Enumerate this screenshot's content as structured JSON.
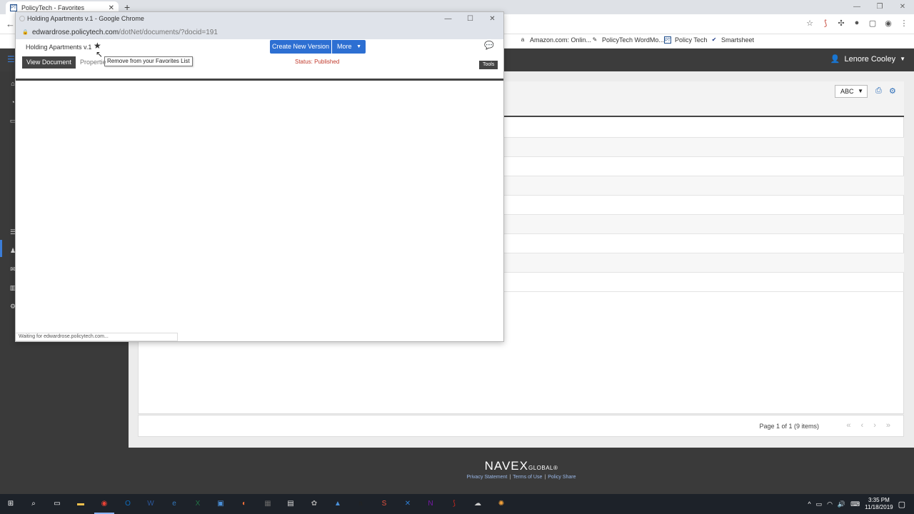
{
  "browser": {
    "tab_title": "PolicyTech - Favorites",
    "tab_favicon": "PT",
    "tab_close": "✕",
    "new_tab": "+",
    "back": "←",
    "window_controls": [
      "—",
      "❐",
      "✕"
    ]
  },
  "bookmarks": [
    {
      "label": "Amazon.com: Onlin...",
      "icon": "a"
    },
    {
      "label": "PolicyTech WordMo...",
      "icon": "✎"
    },
    {
      "label": "Policy Tech",
      "icon": "PT"
    },
    {
      "label": "Smartsheet",
      "icon": "✔"
    }
  ],
  "app": {
    "user_name": "Lenore Cooley",
    "menu_icon": "☰",
    "sort_select": "ABC",
    "pager_text": "Page 1 of 1 (9 items)",
    "pager_buttons": [
      "«",
      "‹",
      "›",
      "»"
    ]
  },
  "footer": {
    "logo_main": "NAVEX",
    "logo_small": "GLOBAL",
    "logo_mark": "®",
    "links": [
      "Privacy Statement",
      "Terms of Use",
      "Policy Share"
    ]
  },
  "popup": {
    "window_title": "Holding Apartments v.1 - Google Chrome",
    "url_host": "edwardrose.policytech.com",
    "url_path": "/dotNet/documents/?docid=191",
    "document_title": "Holding Apartments v.1",
    "tooltip": "Remove from your Favorites List",
    "create_new_version": "Create New Version",
    "more": "More",
    "view_document_tab": "View Document",
    "properties_tab": "Propertie",
    "status": "Status: Published",
    "tools": "Tools",
    "status_bar": "Waiting for edwardrose.policytech.com..."
  },
  "taskbar": {
    "time": "3:35 PM",
    "date": "11/18/2019",
    "icons": [
      {
        "name": "start",
        "glyph": "⊞",
        "color": "#ffffff"
      },
      {
        "name": "search",
        "glyph": "⌕",
        "color": "#ffffff"
      },
      {
        "name": "task-view",
        "glyph": "▭",
        "color": "#ffffff"
      },
      {
        "name": "file-explorer",
        "glyph": "▬",
        "color": "#f2c14e"
      },
      {
        "name": "chrome",
        "glyph": "◉",
        "color": "#e94235"
      },
      {
        "name": "outlook",
        "glyph": "O",
        "color": "#0f6cbd"
      },
      {
        "name": "word",
        "glyph": "W",
        "color": "#2b579a"
      },
      {
        "name": "edge",
        "glyph": "e",
        "color": "#3277bc"
      },
      {
        "name": "excel",
        "glyph": "X",
        "color": "#217346"
      },
      {
        "name": "remote",
        "glyph": "▣",
        "color": "#4a90d9"
      },
      {
        "name": "firefox",
        "glyph": "◐",
        "color": "#ff7139"
      },
      {
        "name": "calculator",
        "glyph": "▦",
        "color": "#666666"
      },
      {
        "name": "notepad",
        "glyph": "▤",
        "color": "#dddddd"
      },
      {
        "name": "tools",
        "glyph": "✿",
        "color": "#aaaaaa"
      },
      {
        "name": "uploader",
        "glyph": "▲",
        "color": "#4a90d9"
      },
      {
        "name": "amazon",
        "glyph": "a",
        "color": "#222222"
      },
      {
        "name": "snagit",
        "glyph": "S",
        "color": "#e8523f"
      },
      {
        "name": "x-app",
        "glyph": "✕",
        "color": "#2d7dd2"
      },
      {
        "name": "onenote",
        "glyph": "N",
        "color": "#7719aa"
      },
      {
        "name": "acrobat",
        "glyph": "⟆",
        "color": "#d4271e"
      },
      {
        "name": "cloud",
        "glyph": "☁",
        "color": "#cccccc"
      },
      {
        "name": "sun-app",
        "glyph": "✺",
        "color": "#f4a23a"
      }
    ]
  }
}
